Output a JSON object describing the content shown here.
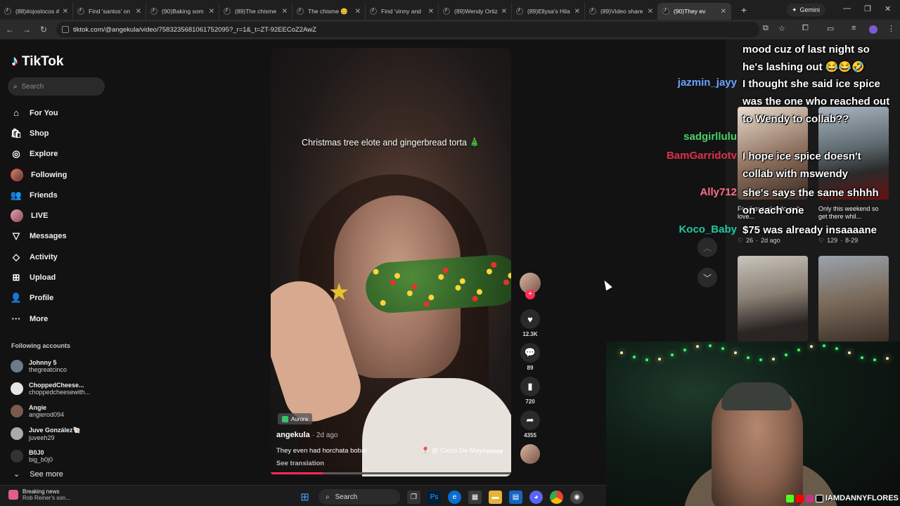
{
  "browser": {
    "tabs": [
      {
        "title": "(88)#ojoslocos #"
      },
      {
        "title": "Find 'santos' on"
      },
      {
        "title": "(90)Baking som"
      },
      {
        "title": "(89)The chisme"
      },
      {
        "title": "The chisme 😊"
      },
      {
        "title": "Find 'vinny and"
      },
      {
        "title": "(89)Wendy Ortiz"
      },
      {
        "title": "(89)Ellysa's Hila"
      },
      {
        "title": "(89)Video share"
      },
      {
        "title": "(90)They ev",
        "active": true
      }
    ],
    "gemini_label": "Gemini",
    "url": "tiktok.com/@angekula/video/7583235681061752095?_r=1&_t=ZT-92EECoZ2AwZ"
  },
  "sidebar": {
    "brand": "TikTok",
    "search_placeholder": "Search",
    "nav": [
      {
        "label": "For You",
        "icon": "home-icon",
        "glyph": "⌂"
      },
      {
        "label": "Shop",
        "icon": "shop-bag-icon",
        "glyph": "🛍"
      },
      {
        "label": "Explore",
        "icon": "compass-icon",
        "glyph": "◎"
      },
      {
        "label": "Following",
        "icon": "following-avatar-icon",
        "glyph": ""
      },
      {
        "label": "Friends",
        "icon": "friends-icon",
        "glyph": "👥"
      },
      {
        "label": "LIVE",
        "icon": "live-avatar-icon",
        "glyph": ""
      },
      {
        "label": "Messages",
        "icon": "messages-icon",
        "glyph": "▽",
        "badge": "85"
      },
      {
        "label": "Activity",
        "icon": "activity-icon",
        "glyph": "◇",
        "badge": "5"
      },
      {
        "label": "Upload",
        "icon": "upload-icon",
        "glyph": "⊞"
      },
      {
        "label": "Profile",
        "icon": "profile-icon",
        "glyph": "👤"
      },
      {
        "label": "More",
        "icon": "more-dots-icon",
        "glyph": "···"
      }
    ],
    "following_title": "Following accounts",
    "following": [
      {
        "name": "Johnny 5",
        "handle": "thegreatcinco",
        "color": "#6a7b8c"
      },
      {
        "name": "ChoppedCheese...",
        "handle": "choppedcheesewith...",
        "color": "#e5e5e5"
      },
      {
        "name": "Angie",
        "handle": "angierod094",
        "color": "#7a5a4a"
      },
      {
        "name": "Juve González🐚",
        "handle": "juveeh29",
        "color": "#aaaaaa"
      },
      {
        "name": "B0J0",
        "handle": "big_b0j0",
        "color": "#333333"
      }
    ],
    "see_more": "See more"
  },
  "video": {
    "overlay_caption": "Christmas tree elote and gingerbread torta 🎄",
    "effect_label": "Aurora",
    "author": "angekula",
    "posted": "· 2d ago",
    "description": "They even had horchata boba!",
    "location": "@ Cinco De Mayo",
    "more": "more",
    "see_translation": "See translation",
    "progress": 0.22
  },
  "actions": {
    "likes": "12.3K",
    "comments": "89",
    "saves": "720",
    "shares": "4355"
  },
  "recommended": [
    {
      "caption": "For those who doesn't love...",
      "likes": "26",
      "date": "2d ago"
    },
    {
      "caption": "Only this weekend so get there whil...",
      "likes": "129",
      "date": "8-29"
    }
  ],
  "chat": [
    {
      "user": "",
      "message": "mood cuz of last night so he's lashing out 😂😂🤣",
      "color": "#ffffff"
    },
    {
      "user": "jazmin_jayy",
      "message": "I thought she said ice spice was the one who reached out to Wendy to collab??",
      "color": "#6aa2ff"
    },
    {
      "user": "sadgirllulu",
      "message": "I hope ice spice doesn't collab with mswendy",
      "color": "#4bd06a"
    },
    {
      "user": "BamGarridotv",
      "message": "",
      "color": "#e0304a"
    },
    {
      "user": "Ally712",
      "message": "she's says the same shhhh on each one",
      "color": "#ff6f8a"
    },
    {
      "user": "Koco_Baby",
      "message": "$75 was already insaaaane",
      "color": "#20c9a0"
    }
  ],
  "streamer": {
    "handle": "IAMDANNYFLORES"
  },
  "taskbar": {
    "news_title": "Breaking news",
    "news_sub": "Rob Reiner's son...",
    "search_label": "Search"
  }
}
